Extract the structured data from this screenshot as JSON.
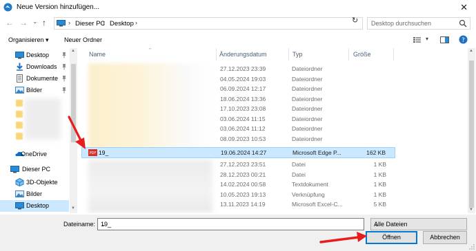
{
  "window": {
    "title": "Neue Version hinzufügen...",
    "close_glyph": "✕"
  },
  "nav": {
    "back": "←",
    "forward": "→",
    "dropdown": "⌄",
    "up": "↑",
    "refresh": "↻"
  },
  "address": {
    "crumbs": [
      "Dieser PC",
      "Desktop"
    ],
    "sep": "›"
  },
  "search": {
    "placeholder": "Desktop durchsuchen"
  },
  "toolbar": {
    "organize": "Organisieren ▾",
    "new_folder": "Neuer Ordner"
  },
  "sidebar": {
    "items": [
      {
        "label": "Desktop",
        "icon": "desktop-icon",
        "pinned": true
      },
      {
        "label": "Downloads",
        "icon": "download-icon",
        "pinned": true
      },
      {
        "label": "Dokumente",
        "icon": "documents-icon",
        "pinned": true
      },
      {
        "label": "Bilder",
        "icon": "pictures-icon",
        "pinned": true
      },
      {
        "label": "OneDrive",
        "icon": "onedrive-icon"
      },
      {
        "label": "Dieser PC",
        "icon": "pc-icon"
      },
      {
        "label": "3D-Objekte",
        "icon": "3d-objects-icon"
      },
      {
        "label": "Bilder",
        "icon": "pictures-icon"
      },
      {
        "label": "Desktop",
        "icon": "desktop-icon",
        "selected": true
      }
    ]
  },
  "columns": {
    "name": "Name",
    "date": "Änderungsdatum",
    "type": "Typ",
    "size": "Größe"
  },
  "files": [
    {
      "date": "27.12.2023 23:39",
      "type": "Dateiordner",
      "size": ""
    },
    {
      "date": "04.05.2024 19:03",
      "type": "Dateiordner",
      "size": ""
    },
    {
      "date": "06.09.2024 12:17",
      "type": "Dateiordner",
      "size": ""
    },
    {
      "date": "18.06.2024 13:36",
      "type": "Dateiordner",
      "size": ""
    },
    {
      "date": "17.10.2023 23:08",
      "type": "Dateiordner",
      "size": ""
    },
    {
      "date": "03.06.2024 11:15",
      "type": "Dateiordner",
      "size": ""
    },
    {
      "date": "03.06.2024 11:12",
      "type": "Dateiordner",
      "size": ""
    },
    {
      "date": "08.09.2023 10:53",
      "type": "Dateiordner",
      "size": ""
    },
    {
      "name": "19_",
      "date": "19.06.2024 14:27",
      "type": "Microsoft Edge P...",
      "size": "162 KB",
      "selected": true,
      "icon": "pdf-icon"
    },
    {
      "date": "27.12.2023 23:51",
      "type": "Datei",
      "size": "1 KB"
    },
    {
      "date": "28.12.2023 00:21",
      "type": "Datei",
      "size": "1 KB"
    },
    {
      "date": "14.02.2024 00:58",
      "type": "Textdokument",
      "size": "1 KB"
    },
    {
      "date": "10.05.2023 19:13",
      "type": "Verknüpfung",
      "size": "1 KB"
    },
    {
      "date": "13.11.2023 14:19",
      "type": "Microsoft Excel-C...",
      "size": "5 KB"
    }
  ],
  "footer": {
    "filename_label": "Dateiname:",
    "filename_value": "19_",
    "filter": "Alle Dateien",
    "open": "Öffnen",
    "cancel": "Abbrechen"
  },
  "colors": {
    "selection": "#cce8ff",
    "accent": "#0078d7",
    "annotation_arrow": "#e81c1c"
  }
}
